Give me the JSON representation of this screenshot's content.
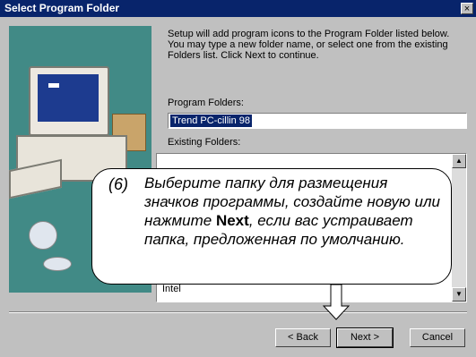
{
  "window": {
    "title": "Select Program Folder",
    "close_glyph": "×"
  },
  "content": {
    "description": "Setup will add program icons to the Program Folder listed below. You may type a new folder name, or select one from the existing Folders list. Click Next to continue.",
    "program_folders_label": "Program Folders:",
    "program_folder_value": "Trend PC-cillin 98",
    "existing_folders_label": "Existing Folders:",
    "existing_folders_visible_item": "Intel"
  },
  "buttons": {
    "back": "< Back",
    "next": "Next >",
    "cancel": "Cancel"
  },
  "callout": {
    "number": "(6)",
    "text_before": "Выберите папку для размещения значков программы, создайте новую или нажмите ",
    "bold": "Next",
    "text_after": ", если вас устраивает папка, предложенная по умолчанию."
  },
  "icons": {
    "scroll_up": "▲",
    "scroll_down": "▼"
  },
  "colors": {
    "titlebar": "#08246b",
    "illustration_bg": "#418a86",
    "dialog_bg": "#c0c0c0"
  }
}
